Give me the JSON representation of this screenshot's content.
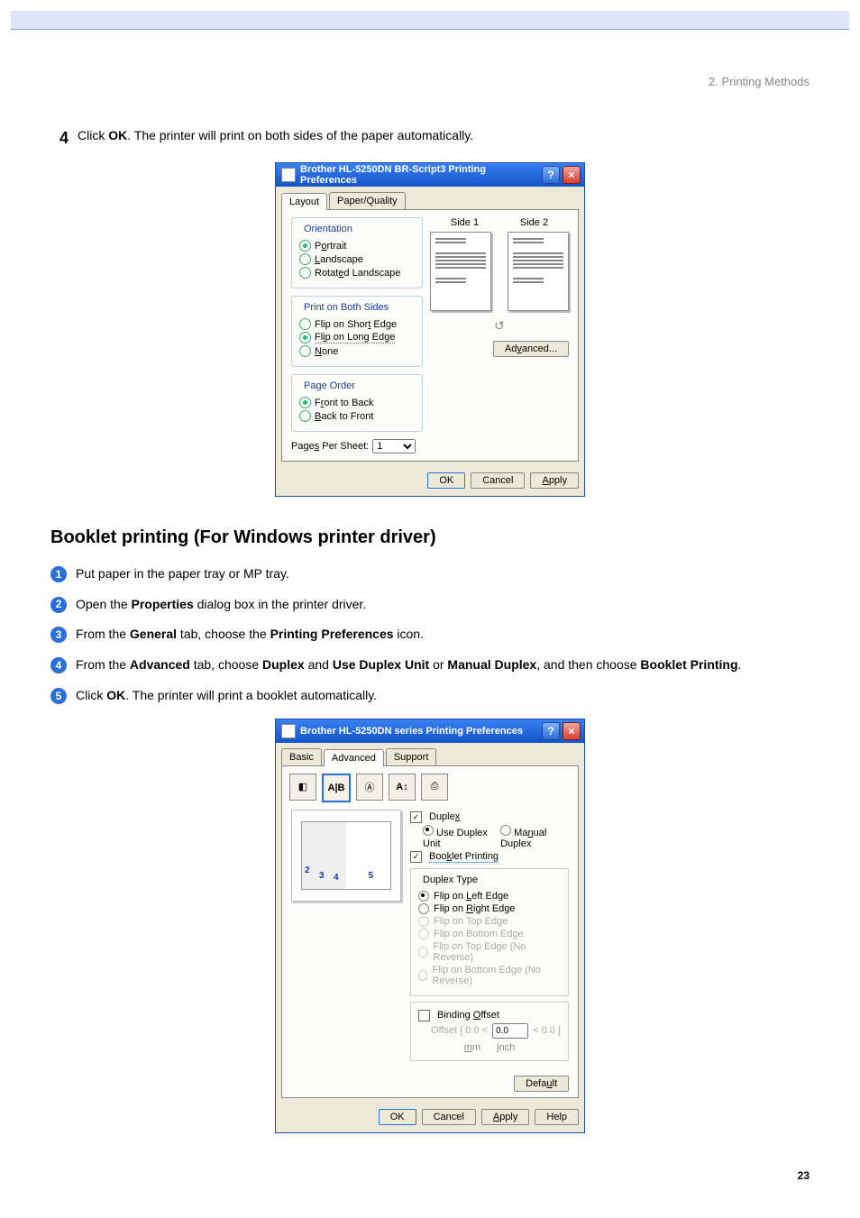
{
  "breadcrumb": "2. Printing Methods",
  "page_number": "23",
  "step4": {
    "num": "4",
    "pre": "Click ",
    "bold": "OK",
    "post": ". The printer will print on both sides of the paper automatically."
  },
  "dlg1": {
    "title": "Brother HL-5250DN BR-Script3 Printing Preferences",
    "tabs": {
      "layout": "Layout",
      "paper": "Paper/Quality"
    },
    "grp_orient": {
      "title": "Orientation",
      "portrait": "Portrait",
      "landscape": "Landscape",
      "rotated": "Rotated Landscape"
    },
    "grp_both": {
      "title": "Print on Both Sides",
      "short": "Flip on Short Edge",
      "long": "Flip on Long Edge",
      "none": "None"
    },
    "grp_order": {
      "title": "Page Order",
      "ftb": "Front to Back",
      "btf": "Back to Front"
    },
    "pps_label": "Pages Per Sheet:",
    "pps_value": "1",
    "side1": "Side 1",
    "side2": "Side 2",
    "advanced": "Advanced...",
    "ok": "OK",
    "cancel": "Cancel",
    "apply": "Apply"
  },
  "h2": "Booklet printing (For Windows printer driver)",
  "ol": {
    "1": "Put paper in the paper tray or MP tray.",
    "2_pre": "Open the ",
    "2_b": "Properties",
    "2_post": " dialog box in the printer driver.",
    "3_pre": "From the ",
    "3_b1": "General",
    "3_mid": " tab, choose the ",
    "3_b2": "Printing Preferences",
    "3_post": " icon.",
    "4_pre": "From the ",
    "4_b1": "Advanced",
    "4_mid1": " tab, choose ",
    "4_b2": "Duplex",
    "4_mid2": " and ",
    "4_b3": "Use Duplex Unit",
    "4_mid3": " or ",
    "4_b4": "Manual Duplex",
    "4_mid4": ", and then choose ",
    "4_b5": "Booklet Printing",
    "4_post": ".",
    "5_pre": "Click ",
    "5_b": "OK",
    "5_post": ". The printer will print a booklet automatically."
  },
  "dlg2": {
    "title": "Brother HL-5250DN series Printing Preferences",
    "tabs": {
      "basic": "Basic",
      "advanced": "Advanced",
      "support": "Support"
    },
    "duplex_label": "Duplex",
    "use_unit": "Use Duplex Unit",
    "manual": "Manual Duplex",
    "booklet": "Booklet Printing",
    "duplex_type": "Duplex Type",
    "opts": {
      "left": "Flip on Left Edge",
      "right": "Flip on Right Edge",
      "top": "Flip on Top Edge",
      "bottom": "Flip on Bottom Edge",
      "top_nr": "Flip on Top Edge (No Reverse)",
      "bottom_nr": "Flip on Bottom Edge (No Reverse)"
    },
    "binding": "Binding Offset",
    "offset_label": "Offset [   0.0 <",
    "offset_val": "0.0",
    "offset_post": "<   0.0      ]",
    "mm": "mm",
    "inch": "inch",
    "default": "Default",
    "ok": "OK",
    "cancel": "Cancel",
    "apply": "Apply",
    "help": "Help"
  }
}
